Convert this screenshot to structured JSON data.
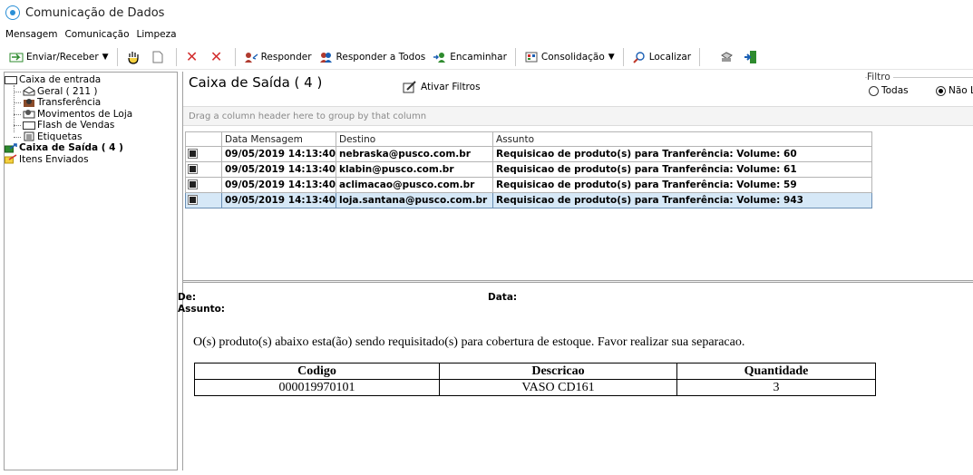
{
  "window": {
    "title": "Comunicação de Dados"
  },
  "menu": [
    "Mensagem",
    "Comunicação",
    "Limpeza"
  ],
  "toolbar": {
    "send_receive": "Enviar/Receber",
    "reply": "Responder",
    "reply_all": "Responder a Todos",
    "forward": "Encaminhar",
    "consolidation": "Consolidação",
    "find": "Localizar"
  },
  "tree": {
    "inbox": "Caixa de entrada",
    "geral": "Geral ( 211 )",
    "transferencia": "Transferência",
    "movimentos": "Movimentos de Loja",
    "flash": "Flash de Vendas",
    "etiquetas": "Etiquetas",
    "outbox": "Caixa de Saída ( 4 )",
    "sent": "Itens Enviados"
  },
  "main": {
    "heading": "Caixa de Saída ( 4 )",
    "activate_filters": "Ativar Filtros",
    "filter_legend": "Filtro",
    "filter_all": "Todas",
    "filter_unread": "Não L",
    "group_hint": "Drag a column header here to group by that column"
  },
  "grid": {
    "columns": [
      "Data Mensagem",
      "Destino",
      "Assunto"
    ],
    "rows": [
      {
        "date": "09/05/2019 14:13:40",
        "dest": "nebraska@pusco.com.br",
        "subject": "Requisicao de produto(s) para Tranferência: Volume: 60"
      },
      {
        "date": "09/05/2019 14:13:40",
        "dest": "klabin@pusco.com.br",
        "subject": "Requisicao de produto(s) para Tranferência: Volume: 61"
      },
      {
        "date": "09/05/2019 14:13:40",
        "dest": "aclimacao@pusco.com.br",
        "subject": "Requisicao de produto(s) para Tranferência: Volume: 59"
      },
      {
        "date": "09/05/2019 14:13:40",
        "dest": "loja.santana@pusco.com.br",
        "subject": "Requisicao de produto(s) para Tranferência: Volume: 943"
      }
    ]
  },
  "preview": {
    "from_label": "De:",
    "date_label": "Data:",
    "subject_label": "Assunto:",
    "body": "O(s) produto(s) abaixo esta(ão) sendo requisitado(s) para cobertura de estoque. Favor realizar sua separacao.",
    "table_headers": [
      "Codigo",
      "Descricao",
      "Quantidade"
    ],
    "table_row": [
      "000019970101",
      "VASO CD161",
      "3"
    ]
  }
}
